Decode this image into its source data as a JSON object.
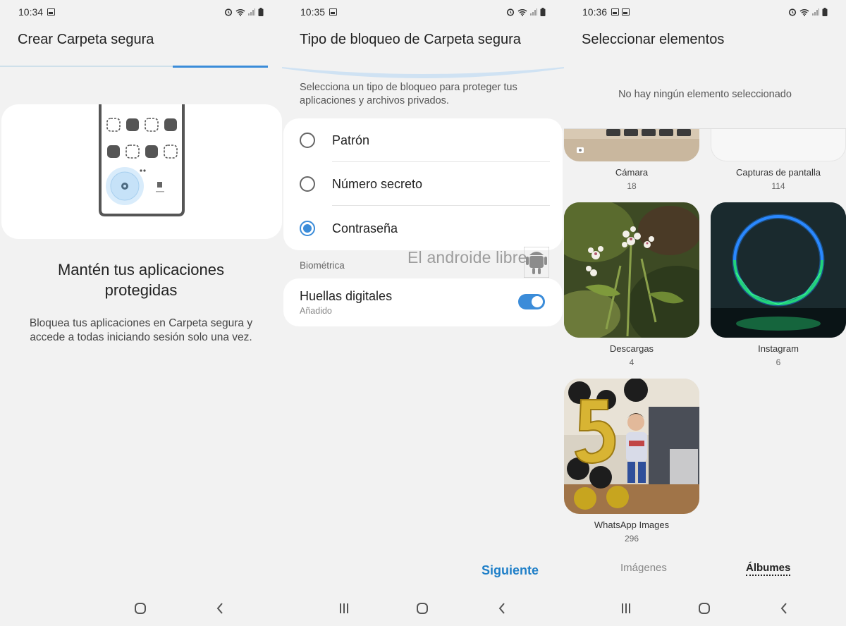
{
  "screen1": {
    "status": {
      "time": "10:34"
    },
    "title": "Crear Carpeta segura",
    "progress": {
      "value_percent": 100,
      "step_split_percent": 64
    },
    "heading": "Mantén tus aplicaciones protegidas",
    "description": "Bloquea tus aplicaciones en Carpeta segura y accede a todas iniciando sesión solo una vez."
  },
  "screen2": {
    "status": {
      "time": "10:35"
    },
    "title": "Tipo de bloqueo de Carpeta segura",
    "intro": "Selecciona un tipo de bloqueo para proteger tus aplicaciones y archivos privados.",
    "options": [
      {
        "label": "Patrón",
        "selected": false
      },
      {
        "label": "Número secreto",
        "selected": false
      },
      {
        "label": "Contraseña",
        "selected": true
      }
    ],
    "watermark": "El androide libre",
    "section_label": "Biométrica",
    "biometric": {
      "title": "Huellas digitales",
      "subtitle": "Añadido",
      "enabled": true
    },
    "next_label": "Siguiente"
  },
  "screen3": {
    "status": {
      "time": "10:36"
    },
    "title": "Seleccionar elementos",
    "selection_info": "No hay ningún elemento seleccionado",
    "albums": [
      {
        "name": "Cámara",
        "count": "18"
      },
      {
        "name": "Capturas de pantalla",
        "count": "114"
      },
      {
        "name": "Descargas",
        "count": "4"
      },
      {
        "name": "Instagram",
        "count": "6"
      },
      {
        "name": "WhatsApp Images",
        "count": "296"
      }
    ],
    "tabs": {
      "images": "Imágenes",
      "albums": "Álbumes",
      "active": "albums"
    }
  },
  "colors": {
    "accent": "#3b8cd9",
    "link": "#1f7fc8",
    "background": "#f2f2f2",
    "card": "#ffffff"
  },
  "icons": [
    "image-icon",
    "alarm-icon",
    "wifi-icon",
    "signal-icon",
    "battery-icon",
    "recent-apps-icon",
    "home-icon",
    "back-icon"
  ]
}
